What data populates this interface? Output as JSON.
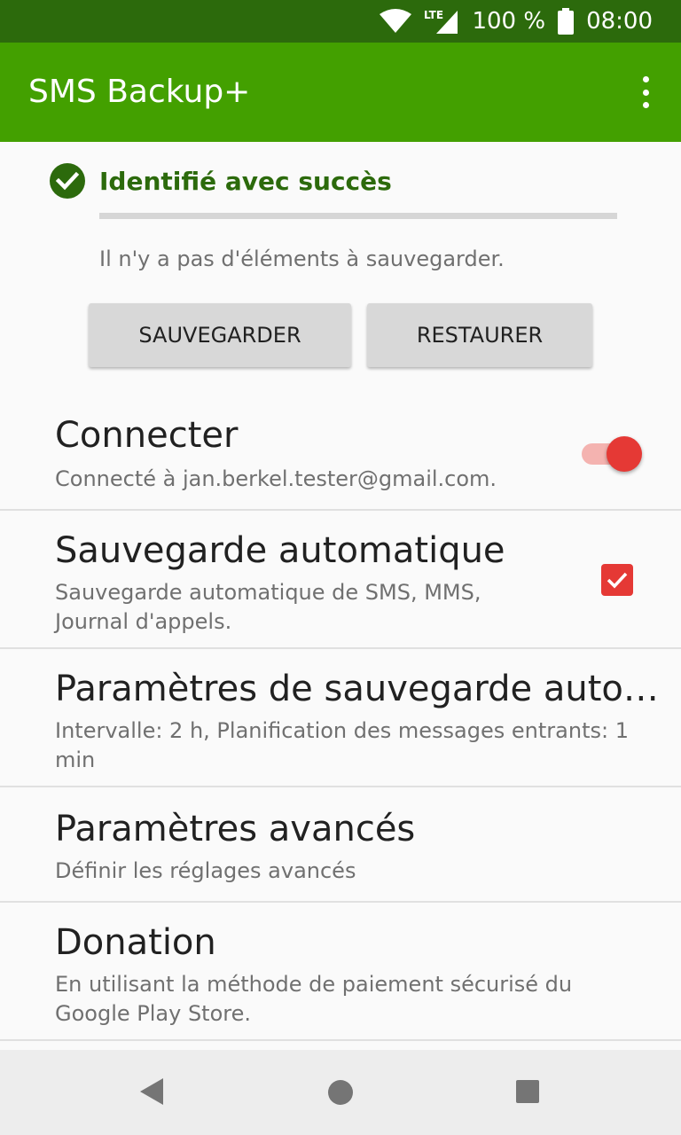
{
  "status_bar": {
    "network": "LTE",
    "battery": "100 %",
    "time": "08:00",
    "icons": [
      "wifi-icon",
      "lte-signal-icon",
      "battery-icon"
    ]
  },
  "app_bar": {
    "title": "SMS Backup+",
    "overflow_icon": "more-vert-icon"
  },
  "login_status": {
    "icon": "check-circle-icon",
    "text": "Identifié avec succès"
  },
  "progress": {
    "value": 0
  },
  "backup_info": "Il n'y a pas d'éléments à sauvegarder.",
  "buttons": {
    "backup": "SAUVEGARDER",
    "restore": "RESTAURER"
  },
  "preferences": [
    {
      "title": "Connecter",
      "summary": "Connecté à jan.berkel.tester@gmail.com.",
      "control": "switch",
      "checked": true
    },
    {
      "title": "Sauvegarde automatique",
      "summary": "Sauvegarde automatique de SMS, MMS, Journal d'appels.",
      "control": "checkbox",
      "checked": true
    },
    {
      "title": "Paramètres de sauvegarde auto…",
      "summary": "Intervalle: 2 h, Planification des messages entrants: 1 min"
    },
    {
      "title": "Paramètres avancés",
      "summary": "Définir les réglages avancés"
    },
    {
      "title": "Donation",
      "summary": "En utilisant la méthode de paiement sécurisé du Google Play Store."
    }
  ],
  "colors": {
    "status_bar": "#2c6a0c",
    "app_bar": "#43a000",
    "success_text": "#2c6a0c",
    "accent": "#e53935"
  },
  "nav_bar": {
    "icons": [
      "back-icon",
      "home-icon",
      "recents-icon"
    ]
  }
}
